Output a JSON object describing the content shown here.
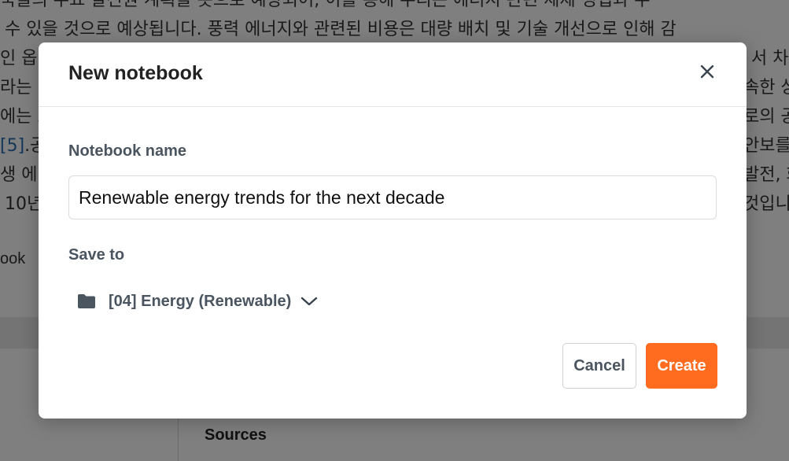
{
  "background": {
    "text_lines": [
      "국들의 주요 발전원 계획을 봇으로 예상되어, 이를 통해 우리는 에너지 관련 체제 정립과 우",
      "수 있을 것으로 예상됩니다. 풍력 에너지와 관련된 비용은 대량 배치 및 기술 개선으로 인해 감",
      "인 옵",
      "라는",
      "에는 호",
      "생 에",
      "10년"
    ],
    "text_lines_right": [
      "",
      "",
      "서 차",
      "속한 상",
      "로의 공",
      "발전, 화",
      "것입니"
    ],
    "citation_line": {
      "cite": "[5]",
      "rest": ".공",
      "right": "안보를"
    },
    "notebook_label": "ook",
    "sources_label": "Sources"
  },
  "modal": {
    "title": "New notebook",
    "name_label": "Notebook name",
    "name_value": "Renewable energy trends for the next decade",
    "save_to_label": "Save to",
    "folder_name": "[04] Energy (Renewable)",
    "cancel_label": "Cancel",
    "create_label": "Create"
  },
  "icons": {
    "close": "close-icon",
    "folder": "folder-icon",
    "chevron": "chevron-down-icon"
  },
  "colors": {
    "accent": "#ff6b1f",
    "label": "#4a5560",
    "overlay": "rgba(0,0,0,0.5)"
  }
}
